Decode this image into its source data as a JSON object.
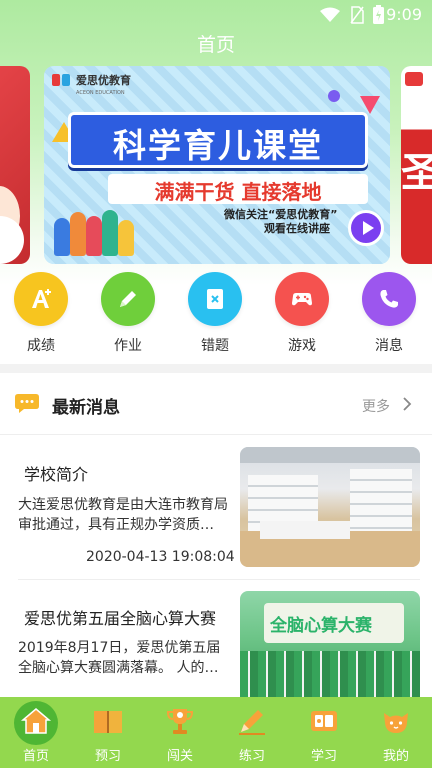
{
  "status_bar": {
    "time": "9:09"
  },
  "header": {
    "title": "首页"
  },
  "banner": {
    "brand_name": "爱思优教育",
    "brand_en": "ACEON EDUCATION",
    "headline": "科学育儿课堂",
    "subheadline": "满满干货 直接落地",
    "wechat_line1": "微信关注“爱思优教育”",
    "wechat_line2": "观看在线讲座"
  },
  "quick_menu": [
    {
      "label": "成绩",
      "icon": "grade-icon",
      "color": "#f7c51f"
    },
    {
      "label": "作业",
      "icon": "pencil-icon",
      "color": "#6fcf3b"
    },
    {
      "label": "错题",
      "icon": "wrong-question-icon",
      "color": "#29c0f0"
    },
    {
      "label": "游戏",
      "icon": "gamepad-icon",
      "color": "#f5524f"
    },
    {
      "label": "消息",
      "icon": "phone-icon",
      "color": "#9c56ee"
    }
  ],
  "news": {
    "title": "最新消息",
    "more": "更多",
    "items": [
      {
        "title": "学校简介",
        "desc": "大连爱思优教育是由大连市教育局审批通过，具有正规办学资质…",
        "date": "2020-04-13 19:08:04"
      },
      {
        "title": "爱思优第五届全脑心算大赛",
        "desc": "2019年8月17日，爱思优第五届全脑心算大赛圆满落幕。 人的…",
        "image_text": "全脑心算大赛"
      }
    ]
  },
  "tabbar": [
    {
      "label": "首页",
      "icon": "home-icon",
      "active": true
    },
    {
      "label": "预习",
      "icon": "book-icon",
      "active": false
    },
    {
      "label": "闯关",
      "icon": "trophy-icon",
      "active": false
    },
    {
      "label": "练习",
      "icon": "practice-pencil-icon",
      "active": false
    },
    {
      "label": "学习",
      "icon": "study-icon",
      "active": false
    },
    {
      "label": "我的",
      "icon": "cat-profile-icon",
      "active": false
    }
  ],
  "colors": {
    "accent": "#93d84e",
    "header_top": "#aeeaa0"
  }
}
